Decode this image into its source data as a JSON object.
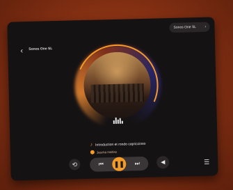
{
  "header": {
    "title": "Sonos One SL",
    "back_icon": "chevron-left-icon"
  },
  "device_selector": {
    "label": "Sonos One SL",
    "icon": "chevron-right-icon"
  },
  "now_playing": {
    "track": "Introduction et rondo capriccioso",
    "artist": "Jascha Heifetz",
    "progress": 0.2
  },
  "controls": {
    "repeat_icon": "repeat-icon",
    "prev_icon": "skip-previous-icon",
    "play_icon": "pause-icon",
    "next_icon": "skip-next-icon",
    "volume_icon": "volume-icon",
    "queue_icon": "queue-list-icon"
  },
  "colors": {
    "accent": "#f39a28",
    "background": "#151213",
    "surround": "#7a2a12"
  }
}
